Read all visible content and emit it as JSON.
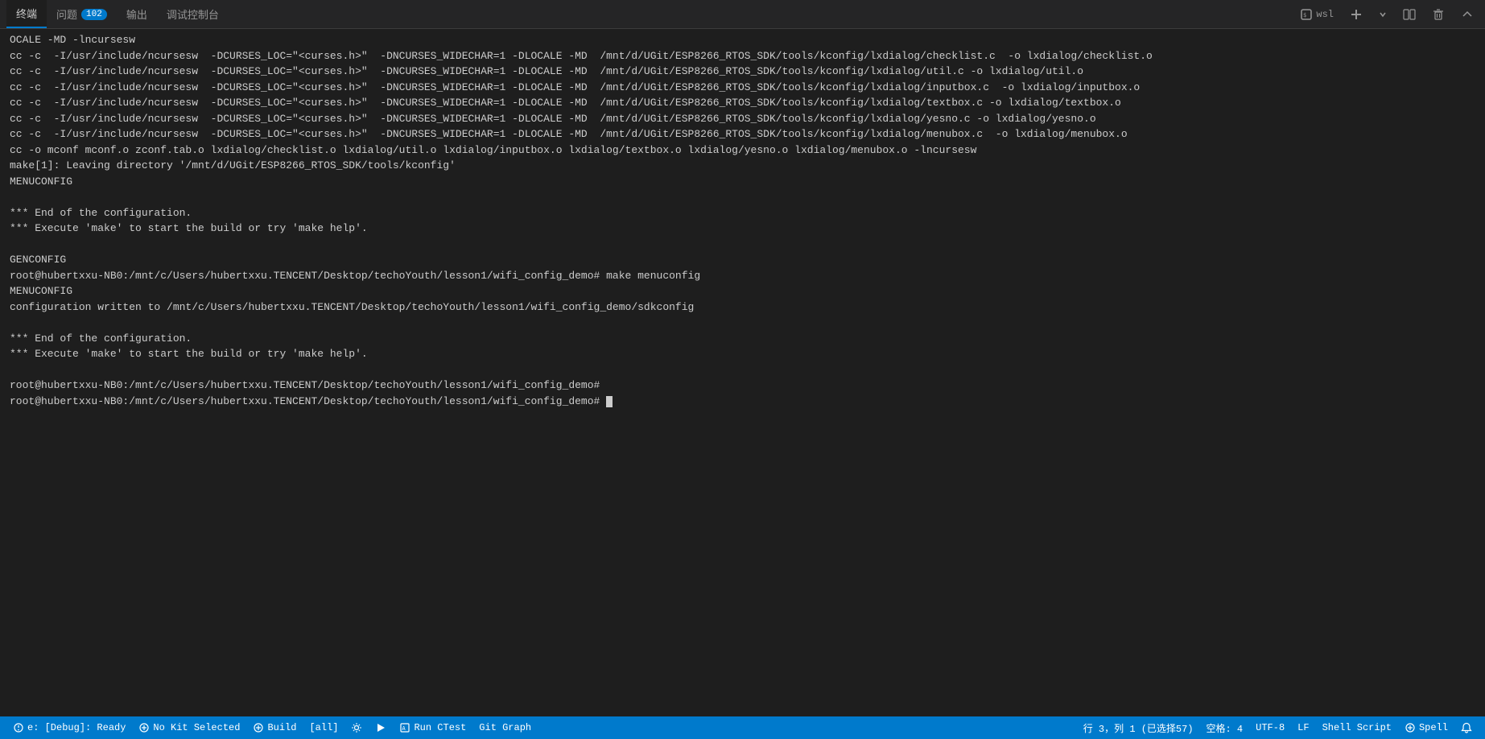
{
  "tabs": {
    "items": [
      {
        "label": "终端",
        "active": true
      },
      {
        "label": "问题",
        "active": false
      },
      {
        "label": "102",
        "badge": true
      },
      {
        "label": "输出",
        "active": false
      },
      {
        "label": "调试控制台",
        "active": false
      }
    ],
    "wsl_label": "wsl",
    "icons": {
      "settings": "⚙",
      "add": "+",
      "split": "⧉",
      "delete": "🗑",
      "collapse": "∧"
    }
  },
  "terminal": {
    "lines": [
      "OCALE -MD -lncursesw",
      "cc -c  -I/usr/include/ncursesw  -DCURSES_LOC=\"<curses.h>\"  -DNCURSES_WIDECHAR=1 -DLOCALE -MD  /mnt/d/UGit/ESP8266_RTOS_SDK/tools/kconfig/lxdialog/checklist.c  -o lxdialog/checklist.o",
      "cc -c  -I/usr/include/ncursesw  -DCURSES_LOC=\"<curses.h>\"  -DNCURSES_WIDECHAR=1 -DLOCALE -MD  /mnt/d/UGit/ESP8266_RTOS_SDK/tools/kconfig/lxdialog/util.c -o lxdialog/util.o",
      "cc -c  -I/usr/include/ncursesw  -DCURSES_LOC=\"<curses.h>\"  -DNCURSES_WIDECHAR=1 -DLOCALE -MD  /mnt/d/UGit/ESP8266_RTOS_SDK/tools/kconfig/lxdialog/inputbox.c  -o lxdialog/inputbox.o",
      "cc -c  -I/usr/include/ncursesw  -DCURSES_LOC=\"<curses.h>\"  -DNCURSES_WIDECHAR=1 -DLOCALE -MD  /mnt/d/UGit/ESP8266_RTOS_SDK/tools/kconfig/lxdialog/textbox.c -o lxdialog/textbox.o",
      "cc -c  -I/usr/include/ncursesw  -DCURSES_LOC=\"<curses.h>\"  -DNCURSES_WIDECHAR=1 -DLOCALE -MD  /mnt/d/UGit/ESP8266_RTOS_SDK/tools/kconfig/lxdialog/yesno.c -o lxdialog/yesno.o",
      "cc -c  -I/usr/include/ncursesw  -DCURSES_LOC=\"<curses.h>\"  -DNCURSES_WIDECHAR=1 -DLOCALE -MD  /mnt/d/UGit/ESP8266_RTOS_SDK/tools/kconfig/lxdialog/menubox.c  -o lxdialog/menubox.o",
      "cc -o mconf mconf.o zconf.tab.o lxdialog/checklist.o lxdialog/util.o lxdialog/inputbox.o lxdialog/textbox.o lxdialog/yesno.o lxdialog/menubox.o -lncursesw",
      "make[1]: Leaving directory '/mnt/d/UGit/ESP8266_RTOS_SDK/tools/kconfig'",
      "MENUCONFIG",
      "",
      "",
      "*** End of the configuration.",
      "*** Execute 'make' to start the build or try 'make help'.",
      "",
      "GENCONFIG",
      "root@hubertxxu-NB0:/mnt/c/Users/hubertxxu.TENCENT/Desktop/techoYouth/lesson1/wifi_config_demo# make menuconfig",
      "MENUCONFIG",
      "configuration written to /mnt/c/Users/hubertxxu.TENCENT/Desktop/techoYouth/lesson1/wifi_config_demo/sdkconfig",
      "",
      "*** End of the configuration.",
      "*** Execute 'make' to start the build or try 'make help'.",
      "",
      "root@hubertxxu-NB0:/mnt/c/Users/hubertxxu.TENCENT/Desktop/techoYouth/lesson1/wifi_config_demo#",
      "root@hubertxxu-NB0:/mnt/c/Users/hubertxxu.TENCENT/Desktop/techoYouth/lesson1/wifi_config_demo# "
    ],
    "cursor": true
  },
  "statusbar": {
    "left": [
      {
        "label": "e: [Debug]: Ready",
        "icon": ""
      },
      {
        "label": "No Kit Selected",
        "icon": "⚙"
      },
      {
        "label": "Build",
        "icon": "⚙"
      },
      {
        "label": "[all]"
      },
      {
        "label": "⚙"
      },
      {
        "label": "▶"
      },
      {
        "label": "Run CTest",
        "icon": "A"
      },
      {
        "label": "Git Graph"
      }
    ],
    "right": [
      {
        "label": "行 3，列 1 (已选择57)"
      },
      {
        "label": "空格: 4"
      },
      {
        "label": "UTF-8"
      },
      {
        "label": "LF"
      },
      {
        "label": "Shell Script"
      },
      {
        "label": "⚙ Spell"
      },
      {
        "label": "⚡"
      }
    ]
  }
}
